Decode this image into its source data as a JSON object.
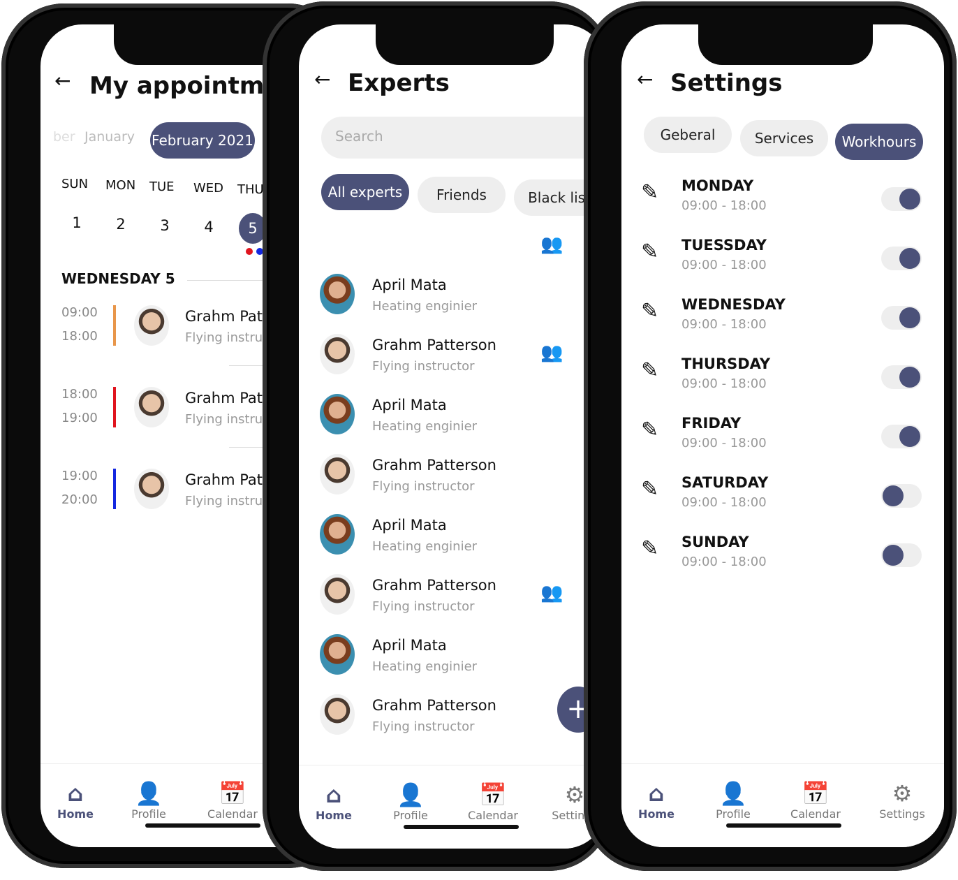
{
  "appointments": {
    "title": "My appointments",
    "months": [
      "ber",
      "January",
      "February 2021"
    ],
    "weekdays": [
      "SUN",
      "MON",
      "TUE",
      "WED",
      "THU"
    ],
    "dates": [
      "1",
      "2",
      "3",
      "4",
      "5"
    ],
    "day_heading": "WEDNESDAY 5",
    "items": [
      {
        "start": "09:00",
        "end": "18:00",
        "name": "Grahm Patterson",
        "role": "Flying instructor",
        "color": "#e8964a"
      },
      {
        "start": "18:00",
        "end": "19:00",
        "name": "Grahm Patterson",
        "role": "Flying instructor",
        "color": "#e0141e"
      },
      {
        "start": "19:00",
        "end": "20:00",
        "name": "Grahm Patterson",
        "role": "Flying instructor",
        "color": "#1428e0"
      }
    ],
    "nav": [
      "Home",
      "Profile",
      "Calendar"
    ]
  },
  "experts": {
    "title": "Experts",
    "search_placeholder": "Search",
    "filters": [
      "All experts",
      "Friends",
      "Black list"
    ],
    "list": [
      {
        "name": "April Mata",
        "role": "Heating enginier",
        "friend": false
      },
      {
        "name": "Grahm Patterson",
        "role": "Flying instructor",
        "friend": true
      },
      {
        "name": "April Mata",
        "role": "Heating enginier",
        "friend": false
      },
      {
        "name": "Grahm Patterson",
        "role": "Flying instructor",
        "friend": false
      },
      {
        "name": "April Mata",
        "role": "Heating enginier",
        "friend": false
      },
      {
        "name": "Grahm Patterson",
        "role": "Flying instructor",
        "friend": true
      },
      {
        "name": "April Mata",
        "role": "Heating enginier",
        "friend": false
      },
      {
        "name": "Grahm Patterson",
        "role": "Flying instructor",
        "friend": false
      }
    ],
    "fab": "+",
    "nav": [
      "Home",
      "Profile",
      "Calendar",
      "Settings"
    ]
  },
  "settings": {
    "title": "Settings",
    "tabs": [
      "Geberal",
      "Services",
      "Workhours"
    ],
    "days": [
      {
        "day": "MONDAY",
        "hours": "09:00 - 18:00",
        "on": true
      },
      {
        "day": "TUESSDAY",
        "hours": "09:00 - 18:00",
        "on": true
      },
      {
        "day": "WEDNESDAY",
        "hours": "09:00 - 18:00",
        "on": true
      },
      {
        "day": "THURSDAY",
        "hours": "09:00 - 18:00",
        "on": true
      },
      {
        "day": "FRIDAY",
        "hours": "09:00 - 18:00",
        "on": true
      },
      {
        "day": "SATURDAY",
        "hours": "09:00 - 18:00",
        "on": false
      },
      {
        "day": "SUNDAY",
        "hours": "09:00 - 18:00",
        "on": false
      }
    ],
    "nav": [
      "Home",
      "Profile",
      "Calendar",
      "Settings"
    ]
  },
  "colors": {
    "accent": "#4b5179"
  }
}
